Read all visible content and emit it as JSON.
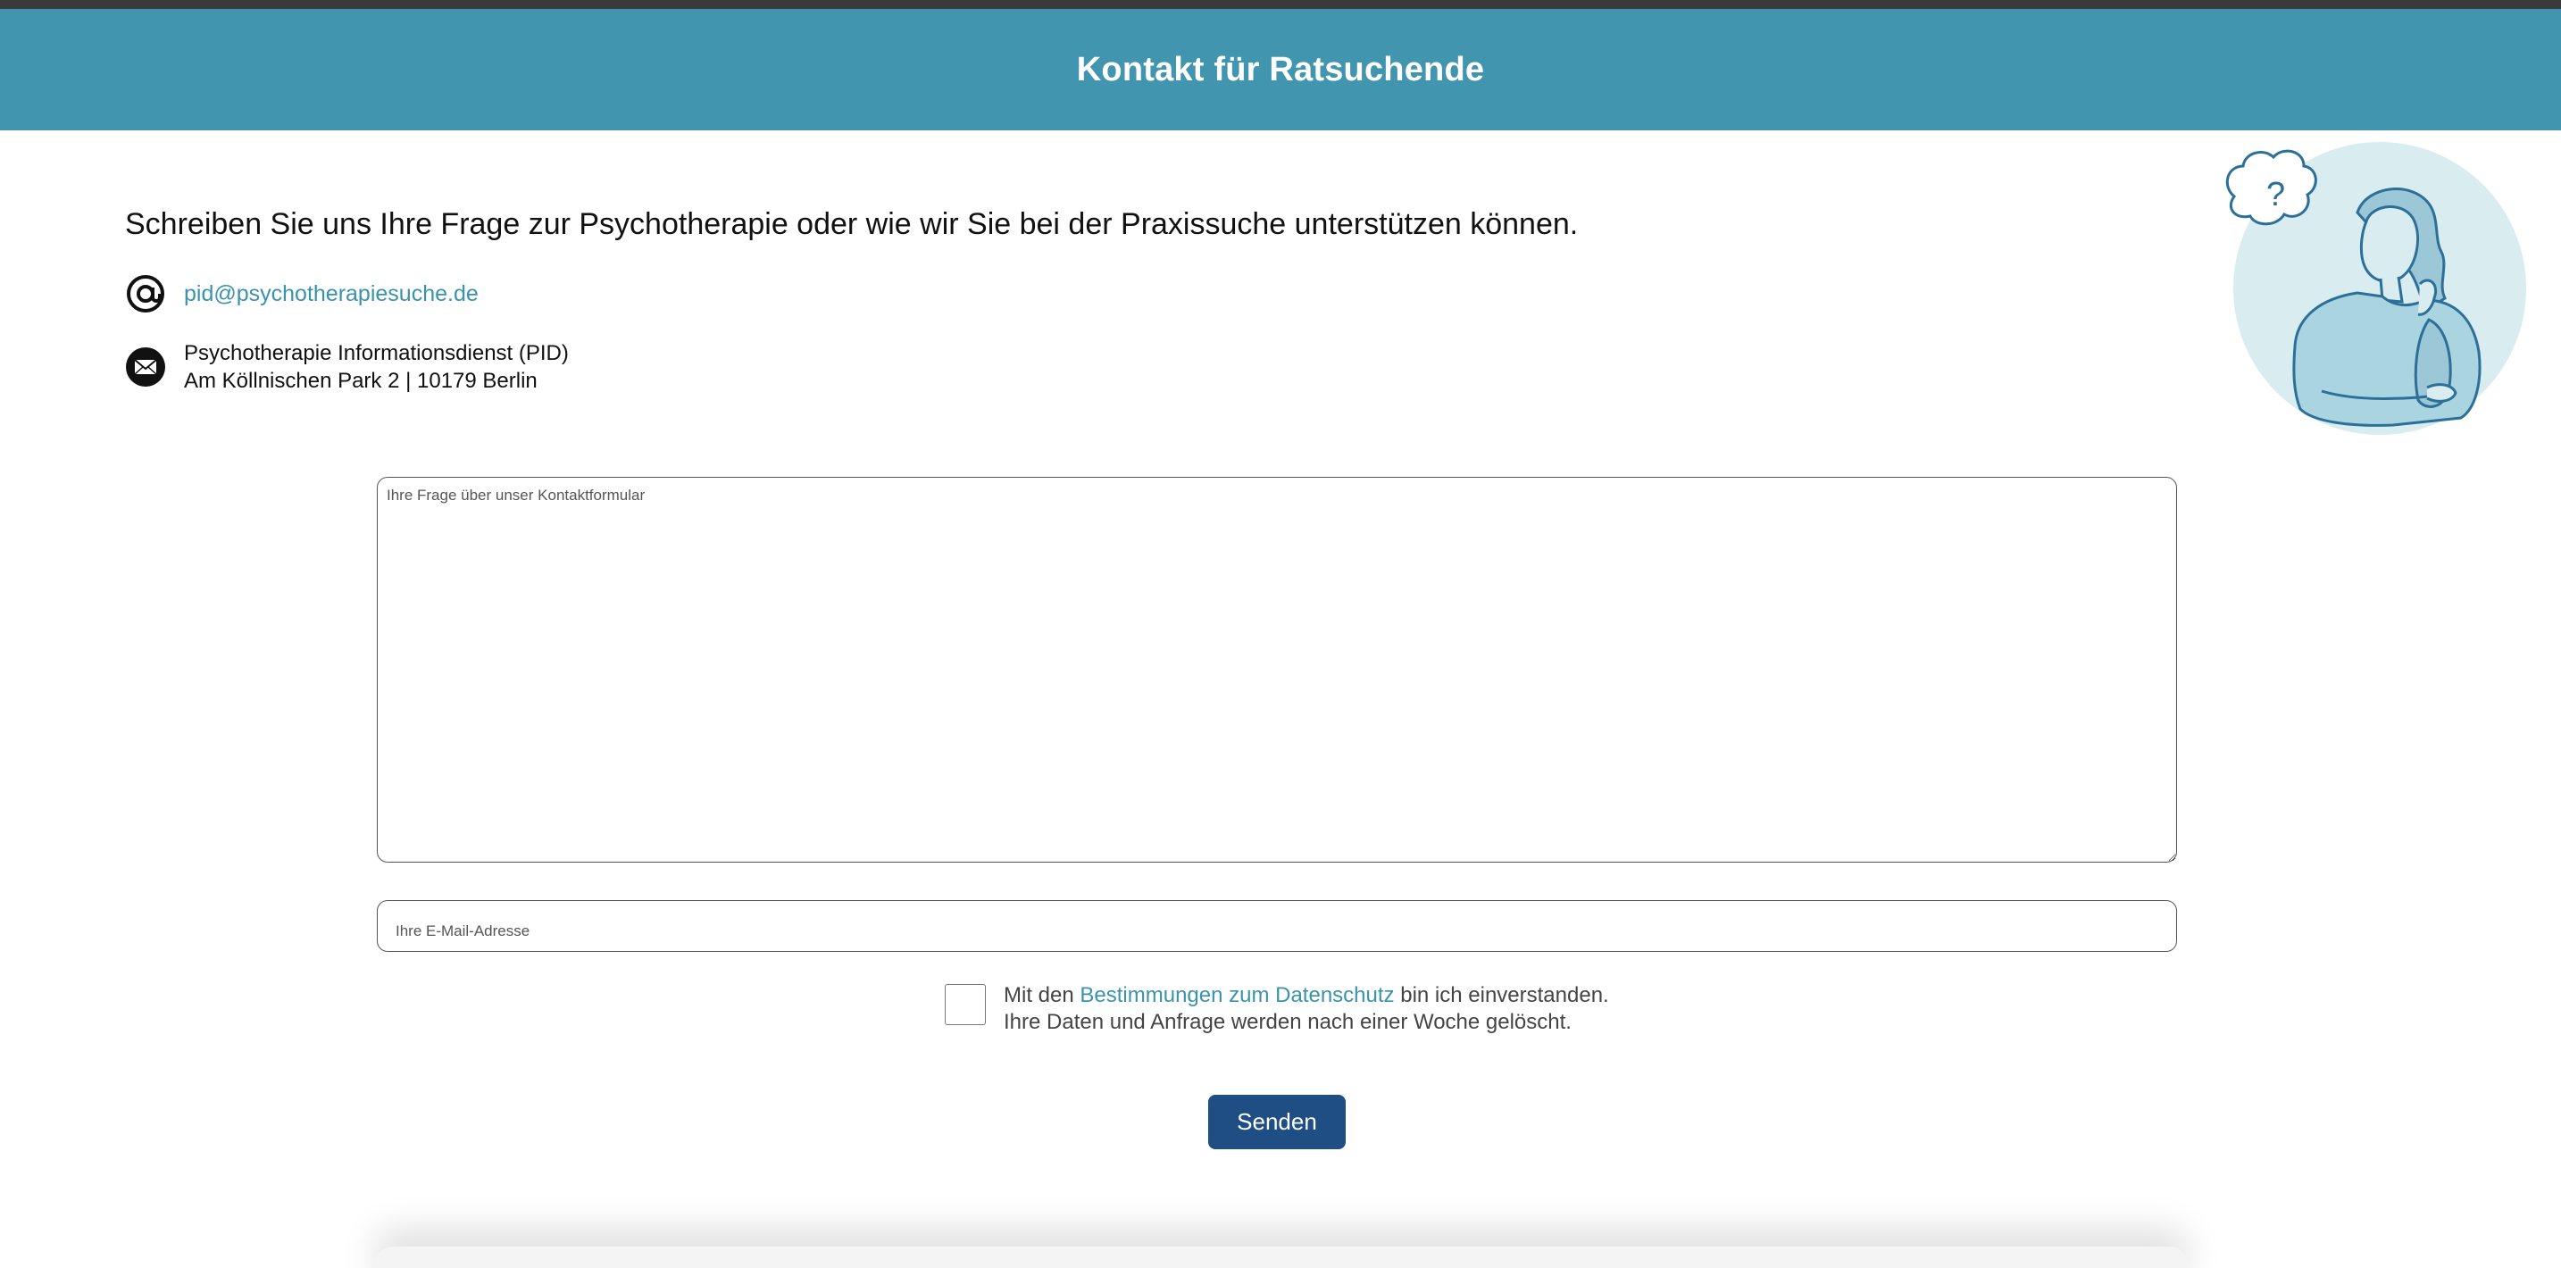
{
  "header": {
    "title": "Kontakt für Ratsuchende"
  },
  "intro": {
    "text": "Schreiben Sie uns Ihre Frage zur Psychotherapie oder wie wir Sie bei der Praxissuche unterstützen können."
  },
  "contact": {
    "email": "pid@psychotherapiesuche.de",
    "address_line1": "Psychotherapie Informationsdienst (PID)",
    "address_line2": "Am Köllnischen Park 2 | 10179 Berlin"
  },
  "form": {
    "question_placeholder": "Ihre Frage über unser Kontaktformular",
    "email_placeholder": "Ihre E-Mail-Adresse",
    "consent_prefix": "Mit den",
    "consent_link": "Bestimmungen zum Datenschutz",
    "consent_suffix": "bin ich einverstanden.",
    "consent_note": "Ihre Daten und Anfrage werden nach einer Woche gelöscht.",
    "submit_label": "Senden"
  },
  "icons": {
    "at": "at-icon",
    "mail": "envelope-icon",
    "illustration": "thinking-person-illustration"
  },
  "colors": {
    "header_bg": "#4295ae",
    "link": "#3a93ad",
    "button_bg": "#1f4e84"
  }
}
